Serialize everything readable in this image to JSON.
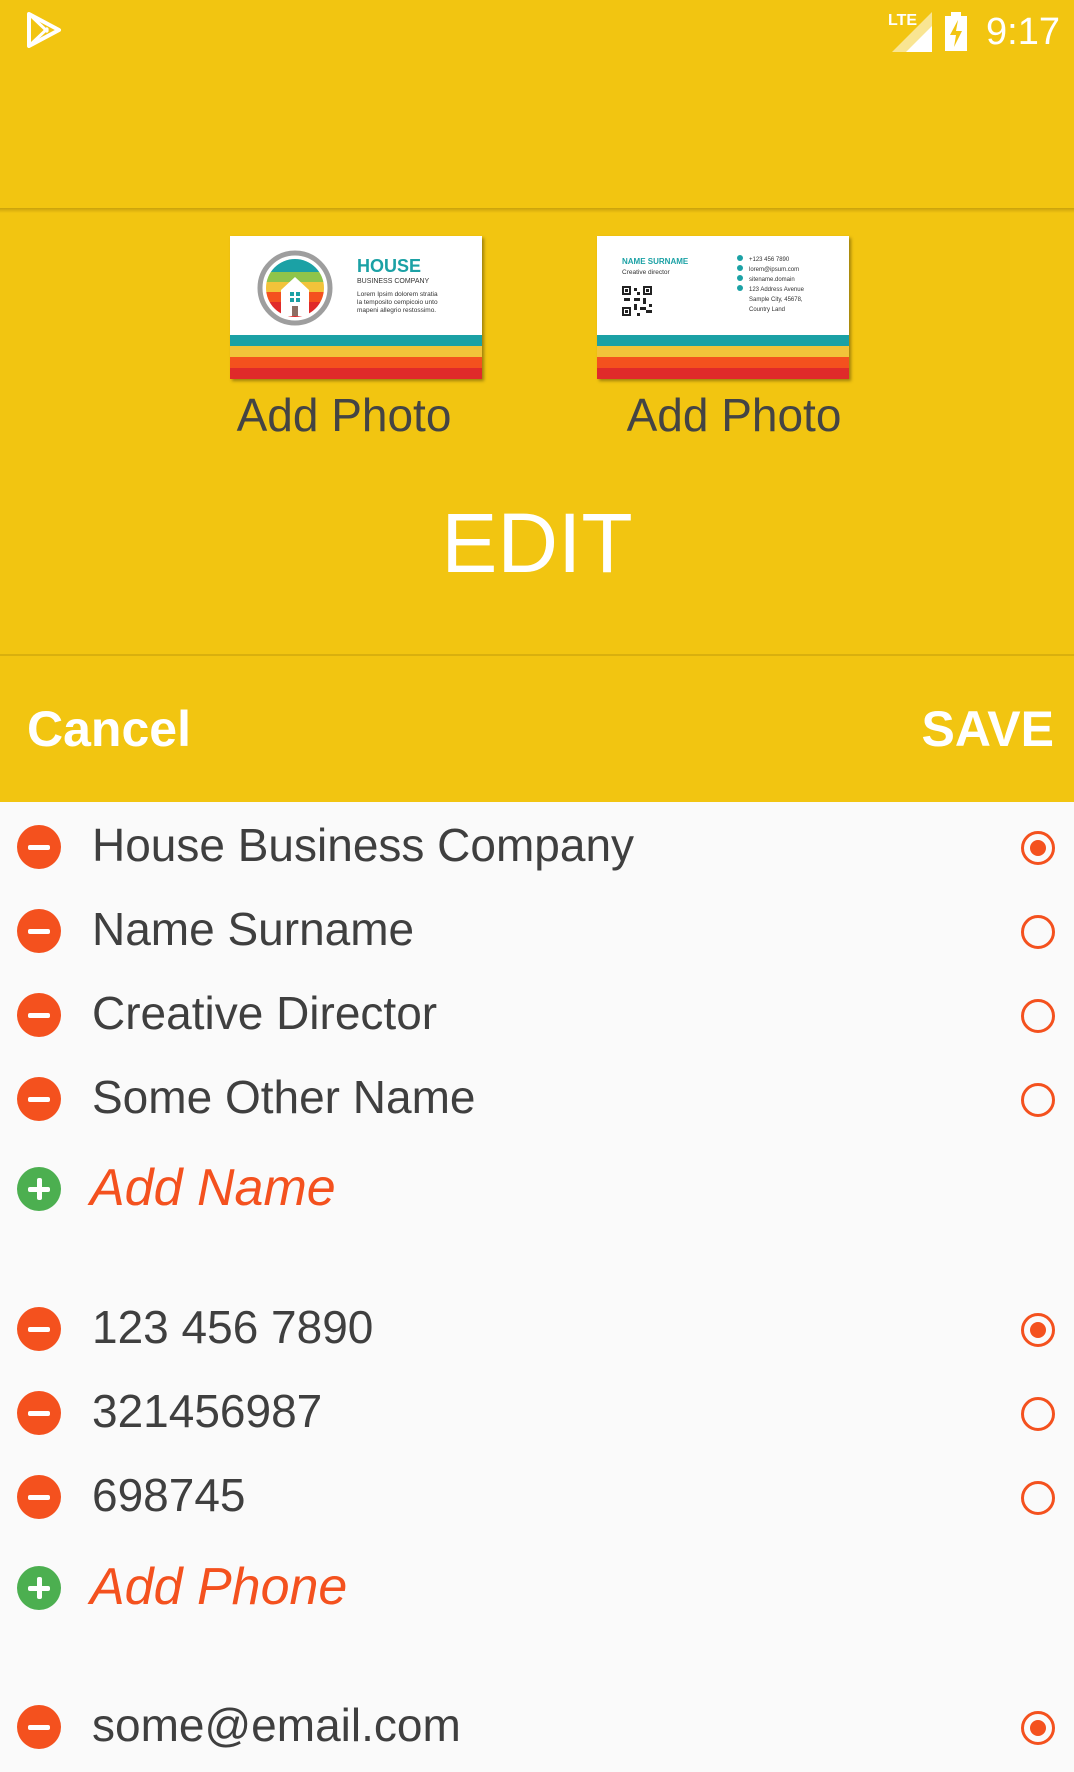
{
  "status_bar": {
    "network": "LTE",
    "time": "9:17"
  },
  "cards": [
    {
      "company": "HOUSE",
      "subtitle": "BUSINESS COMPANY",
      "body": [
        "Lorem Ipsim dolorem stratia",
        "la temposito cempicoio unto",
        "mapeni allegrio restossimo."
      ],
      "add_label": "Add Photo"
    },
    {
      "name": "NAME SURNAME",
      "title": "Creative director",
      "contacts": [
        "+123 456 7890",
        "lorem@ipsum.com",
        "sitename.domain",
        "123 Address Avenue",
        "Sample City, 45678,",
        "Country Land"
      ],
      "add_label": "Add Photo"
    }
  ],
  "header": {
    "title": "EDIT",
    "cancel": "Cancel",
    "save": "SAVE"
  },
  "names": {
    "items": [
      "House Business Company",
      "Name Surname",
      "Creative Director",
      "Some Other Name"
    ],
    "selected": 0,
    "add_label": "Add Name"
  },
  "phones": {
    "items": [
      "123 456 7890",
      "321456987",
      "698745"
    ],
    "selected": 0,
    "add_label": "Add Phone"
  },
  "emails": {
    "items": [
      "some@email.com"
    ],
    "selected": 0
  },
  "colors": {
    "accent": "#f2c511",
    "remove": "#f4511e",
    "add": "#4caf50",
    "card_stripes": [
      "#1ba1a5",
      "#f2c33a",
      "#f4511e",
      "#e02a2a"
    ]
  }
}
